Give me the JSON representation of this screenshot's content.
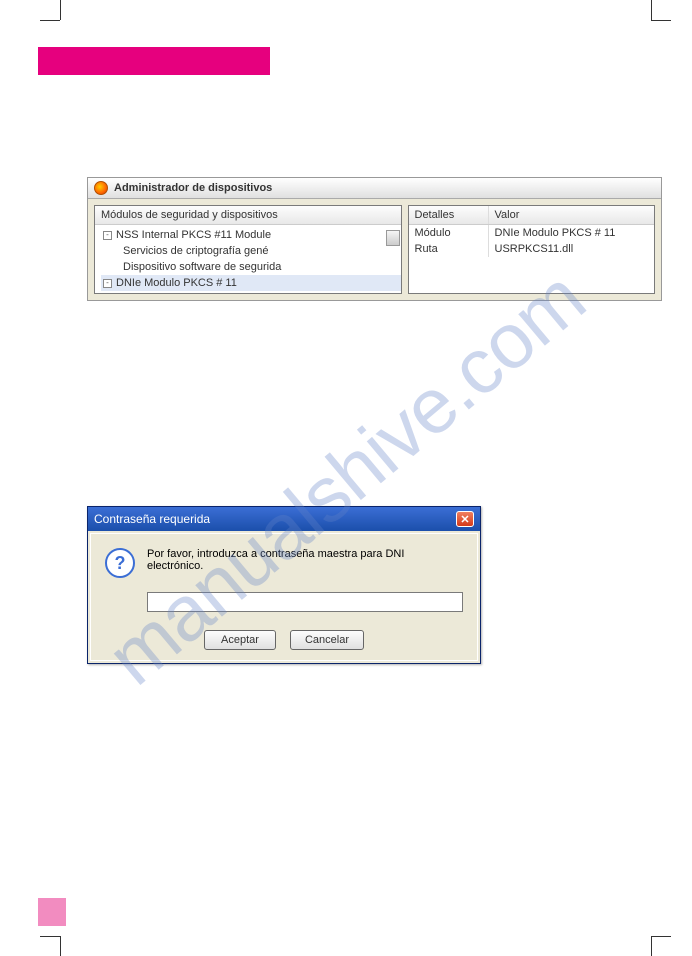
{
  "watermark": "manualshive.com",
  "device_manager": {
    "title": "Administrador de dispositivos",
    "tree_header": "Módulos de seguridad y dispositivos",
    "items": [
      {
        "label": "NSS Internal PKCS #11 Module",
        "expander": "-",
        "indent": 0
      },
      {
        "label": "Servicios de criptografía gené",
        "expander": "",
        "indent": 1
      },
      {
        "label": "Dispositivo software de segurida",
        "expander": "",
        "indent": 1
      },
      {
        "label": "DNIe Modulo PKCS # 11",
        "expander": "-",
        "indent": 0,
        "selected": true
      }
    ],
    "detail_headers": {
      "left": "Detalles",
      "right": "Valor"
    },
    "detail_rows": [
      {
        "left": "Módulo",
        "right": "DNIe Modulo PKCS # 11"
      },
      {
        "left": "Ruta",
        "right": "USRPKCS11.dll"
      }
    ]
  },
  "password_dialog": {
    "title": "Contraseña requerida",
    "message": "Por favor, introduzca a contraseña maestra para DNI electrónico.",
    "accept": "Aceptar",
    "cancel": "Cancelar",
    "close_glyph": "✕",
    "question_glyph": "?"
  }
}
